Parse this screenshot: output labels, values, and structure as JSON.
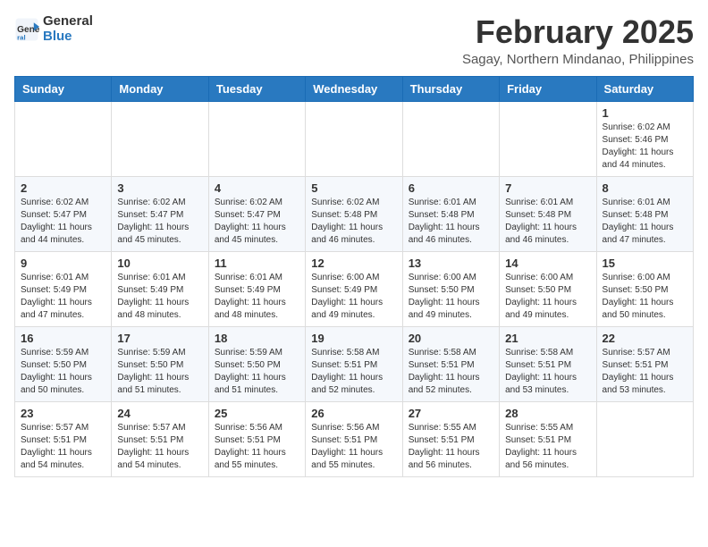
{
  "header": {
    "logo_line1": "General",
    "logo_line2": "Blue",
    "month_year": "February 2025",
    "location": "Sagay, Northern Mindanao, Philippines"
  },
  "weekdays": [
    "Sunday",
    "Monday",
    "Tuesday",
    "Wednesday",
    "Thursday",
    "Friday",
    "Saturday"
  ],
  "weeks": [
    [
      {
        "day": "",
        "info": ""
      },
      {
        "day": "",
        "info": ""
      },
      {
        "day": "",
        "info": ""
      },
      {
        "day": "",
        "info": ""
      },
      {
        "day": "",
        "info": ""
      },
      {
        "day": "",
        "info": ""
      },
      {
        "day": "1",
        "info": "Sunrise: 6:02 AM\nSunset: 5:46 PM\nDaylight: 11 hours\nand 44 minutes."
      }
    ],
    [
      {
        "day": "2",
        "info": "Sunrise: 6:02 AM\nSunset: 5:47 PM\nDaylight: 11 hours\nand 44 minutes."
      },
      {
        "day": "3",
        "info": "Sunrise: 6:02 AM\nSunset: 5:47 PM\nDaylight: 11 hours\nand 45 minutes."
      },
      {
        "day": "4",
        "info": "Sunrise: 6:02 AM\nSunset: 5:47 PM\nDaylight: 11 hours\nand 45 minutes."
      },
      {
        "day": "5",
        "info": "Sunrise: 6:02 AM\nSunset: 5:48 PM\nDaylight: 11 hours\nand 46 minutes."
      },
      {
        "day": "6",
        "info": "Sunrise: 6:01 AM\nSunset: 5:48 PM\nDaylight: 11 hours\nand 46 minutes."
      },
      {
        "day": "7",
        "info": "Sunrise: 6:01 AM\nSunset: 5:48 PM\nDaylight: 11 hours\nand 46 minutes."
      },
      {
        "day": "8",
        "info": "Sunrise: 6:01 AM\nSunset: 5:48 PM\nDaylight: 11 hours\nand 47 minutes."
      }
    ],
    [
      {
        "day": "9",
        "info": "Sunrise: 6:01 AM\nSunset: 5:49 PM\nDaylight: 11 hours\nand 47 minutes."
      },
      {
        "day": "10",
        "info": "Sunrise: 6:01 AM\nSunset: 5:49 PM\nDaylight: 11 hours\nand 48 minutes."
      },
      {
        "day": "11",
        "info": "Sunrise: 6:01 AM\nSunset: 5:49 PM\nDaylight: 11 hours\nand 48 minutes."
      },
      {
        "day": "12",
        "info": "Sunrise: 6:00 AM\nSunset: 5:49 PM\nDaylight: 11 hours\nand 49 minutes."
      },
      {
        "day": "13",
        "info": "Sunrise: 6:00 AM\nSunset: 5:50 PM\nDaylight: 11 hours\nand 49 minutes."
      },
      {
        "day": "14",
        "info": "Sunrise: 6:00 AM\nSunset: 5:50 PM\nDaylight: 11 hours\nand 49 minutes."
      },
      {
        "day": "15",
        "info": "Sunrise: 6:00 AM\nSunset: 5:50 PM\nDaylight: 11 hours\nand 50 minutes."
      }
    ],
    [
      {
        "day": "16",
        "info": "Sunrise: 5:59 AM\nSunset: 5:50 PM\nDaylight: 11 hours\nand 50 minutes."
      },
      {
        "day": "17",
        "info": "Sunrise: 5:59 AM\nSunset: 5:50 PM\nDaylight: 11 hours\nand 51 minutes."
      },
      {
        "day": "18",
        "info": "Sunrise: 5:59 AM\nSunset: 5:50 PM\nDaylight: 11 hours\nand 51 minutes."
      },
      {
        "day": "19",
        "info": "Sunrise: 5:58 AM\nSunset: 5:51 PM\nDaylight: 11 hours\nand 52 minutes."
      },
      {
        "day": "20",
        "info": "Sunrise: 5:58 AM\nSunset: 5:51 PM\nDaylight: 11 hours\nand 52 minutes."
      },
      {
        "day": "21",
        "info": "Sunrise: 5:58 AM\nSunset: 5:51 PM\nDaylight: 11 hours\nand 53 minutes."
      },
      {
        "day": "22",
        "info": "Sunrise: 5:57 AM\nSunset: 5:51 PM\nDaylight: 11 hours\nand 53 minutes."
      }
    ],
    [
      {
        "day": "23",
        "info": "Sunrise: 5:57 AM\nSunset: 5:51 PM\nDaylight: 11 hours\nand 54 minutes."
      },
      {
        "day": "24",
        "info": "Sunrise: 5:57 AM\nSunset: 5:51 PM\nDaylight: 11 hours\nand 54 minutes."
      },
      {
        "day": "25",
        "info": "Sunrise: 5:56 AM\nSunset: 5:51 PM\nDaylight: 11 hours\nand 55 minutes."
      },
      {
        "day": "26",
        "info": "Sunrise: 5:56 AM\nSunset: 5:51 PM\nDaylight: 11 hours\nand 55 minutes."
      },
      {
        "day": "27",
        "info": "Sunrise: 5:55 AM\nSunset: 5:51 PM\nDaylight: 11 hours\nand 56 minutes."
      },
      {
        "day": "28",
        "info": "Sunrise: 5:55 AM\nSunset: 5:51 PM\nDaylight: 11 hours\nand 56 minutes."
      },
      {
        "day": "",
        "info": ""
      }
    ]
  ]
}
